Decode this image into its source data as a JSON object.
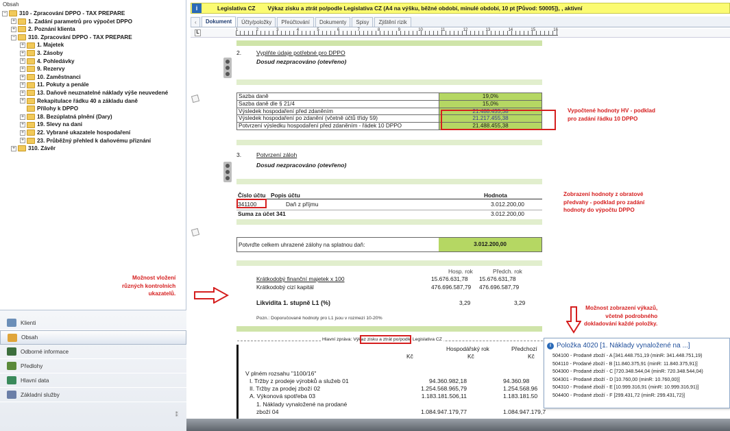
{
  "left_panel": {
    "title": "Obsah",
    "tree": [
      {
        "label": "310 - Zpracování DPPO - TAX PREPARE",
        "indent": 0,
        "exp": "−"
      },
      {
        "label": "1. Zadání parametrů pro výpočet DPPO",
        "indent": 1,
        "exp": "+"
      },
      {
        "label": "2. Poznání klienta",
        "indent": 1,
        "exp": "+"
      },
      {
        "label": "310. Zpracování DPPO - TAX PREPARE",
        "indent": 1,
        "exp": "−"
      },
      {
        "label": "1. Majetek",
        "indent": 2,
        "exp": "+"
      },
      {
        "label": "3. Zásoby",
        "indent": 2,
        "exp": "+"
      },
      {
        "label": "4. Pohledávky",
        "indent": 2,
        "exp": "+"
      },
      {
        "label": "9. Rezervy",
        "indent": 2,
        "exp": "+"
      },
      {
        "label": "10. Zaměstnanci",
        "indent": 2,
        "exp": "+"
      },
      {
        "label": "11. Pokuty a penále",
        "indent": 2,
        "exp": "+"
      },
      {
        "label": "13. Daňově neuznatelné náklady výše neuvedené",
        "indent": 2,
        "exp": "+"
      },
      {
        "label": "Rekapitulace řádku 40 a základu daně",
        "indent": 2,
        "exp": "+"
      },
      {
        "label": "Přílohy k DPPO",
        "indent": 2,
        "exp": ""
      },
      {
        "label": "18. Bezúplatná plnění (Dary)",
        "indent": 2,
        "exp": "+"
      },
      {
        "label": "19. Slevy na dani",
        "indent": 2,
        "exp": "+"
      },
      {
        "label": "22. Vybrané ukazatele hospodaření",
        "indent": 2,
        "exp": "+"
      },
      {
        "label": "23. Průběžný přehled k daňovému přiznání",
        "indent": 2,
        "exp": "+"
      },
      {
        "label": "310. Závěr",
        "indent": 1,
        "exp": "+"
      }
    ],
    "nav": [
      {
        "label": "Klienti",
        "icon": "clients-icon",
        "color": "#6c8fb8",
        "active": false
      },
      {
        "label": "Obsah",
        "icon": "content-icon",
        "color": "#e0a53a",
        "active": true
      },
      {
        "label": "Odborné informace",
        "icon": "library-icon",
        "color": "#3d6f3d",
        "active": false
      },
      {
        "label": "Předlohy",
        "icon": "templates-icon",
        "color": "#5b8a3a",
        "active": false
      },
      {
        "label": "Hlavní data",
        "icon": "main-data-icon",
        "color": "#3a8a5b",
        "active": false
      },
      {
        "label": "Základní služby",
        "icon": "services-icon",
        "color": "#6b7fa8",
        "active": false
      }
    ]
  },
  "topbar": {
    "section": "Legislativa CZ",
    "title": "Výkaz zisku a ztrát po/podle Legislativa CZ (A4 na výšku, běžné období, minulé období, 10 pt [Původ: 50005]), , aktivní"
  },
  "tabs": [
    "Dokument",
    "Účty/položky",
    "Přeúčtování",
    "Dokumenty",
    "Spisy",
    "Zjištění rizik"
  ],
  "ruler_marks": [
    "1",
    "2",
    "3",
    "4",
    "5",
    "6",
    "7",
    "8",
    "9",
    "10",
    "11",
    "12",
    "13",
    "14",
    "15",
    "16"
  ],
  "section2": {
    "num": "2.",
    "link": "Vyplňte údaje potřebné pro DPPO",
    "status": "Dosud nezpracováno (otevřeno)"
  },
  "tax_rows": [
    {
      "label": "Sazba daně",
      "value": "19,0%"
    },
    {
      "label": "Sazba daně dle § 21/4",
      "value": "15,0%"
    },
    {
      "label": "Výsledek hospodaření před zdaněním",
      "value": "21.488.455,38"
    },
    {
      "label": "Výsledek hospodaření po zdanění (včetně účtů třídy 59)",
      "value": "21.217.455,38"
    },
    {
      "label": "Potvrzení výsledku hospodaření před zdaněním - řádek 10 DPPO",
      "value": "21.488.455,38"
    }
  ],
  "section3": {
    "num": "3.",
    "link": "Potvrzení záloh",
    "status": "Dosud nezpracováno (otevřeno)"
  },
  "account": {
    "head_num": "Číslo účtu",
    "head_desc": "Popis účtu",
    "head_val": "Hodnota",
    "row_num": "341100",
    "row_desc": "Daň z příjmu",
    "row_val": "3.012.200,00",
    "sum_label": "Suma za účet 341",
    "sum_val": "3.012.200,00"
  },
  "confirm": {
    "label": "Potvrďte celkem uhrazené zálohy na splatnou daň:",
    "value": "3.012.200,00"
  },
  "liquidity": {
    "col1": "Hosp. rok",
    "col2": "Předch. rok",
    "rows": [
      {
        "label": "Krátkodobý finanční majetek x 100",
        "v1": "15.676.631,78",
        "v2": "15.676.631,78"
      },
      {
        "label": "Krátkodobý cizí kapitál",
        "v1": "476.696.587,79",
        "v2": "476.696.587,79"
      }
    ],
    "total_label": "Likvidita 1. stupně L1 (%)",
    "total_v1": "3,29",
    "total_v2": "3,29",
    "note": "Pozn.: Doporučované hodnoty pro L1 jsou v rozmezí 10-20%"
  },
  "report": {
    "header_pre": "Hlavní zpráva:",
    "header_box": "Výkaz zisku a ztrát",
    "header_post": "po/podle Legislativa CZ",
    "col_kc": "Kč",
    "col_year": "Hospodářský rok",
    "col_prev": "Předchozí",
    "rows": [
      {
        "label": "V plném rozsahu \"1100/16\"",
        "v1": "",
        "v2": ""
      },
      {
        "label": "I. Tržby z prodeje výrobků a služeb 01",
        "v1": "94.360.982,18",
        "v2": "94.360.98"
      },
      {
        "label": "II. Tržby za prodej zboží 02",
        "v1": "1.254.568.965,79",
        "v2": "1.254.568.96"
      },
      {
        "label": "A. Výkonová spotřeba 03",
        "v1": "1.183.181.506,11",
        "v2": "1.183.181.50"
      },
      {
        "label": "1. Náklady vynaložené na prodané",
        "v1": "",
        "v2": ""
      },
      {
        "label": "zboží 04",
        "v1": "1.084.947.179,77",
        "v2": "1.084.947.179,7"
      }
    ]
  },
  "annotations": {
    "hv": [
      "Vypočtené hodnoty HV - podklad",
      "pro zadání řádku 10 DPPO"
    ],
    "obrat": [
      "Zobrazení hodnoty z obratové",
      "předvahy - podklad pro zadání",
      "hodnoty do výpočtu DPPO"
    ],
    "kontrolni": [
      "Možnost vložení",
      "různých kontrolních",
      "ukazatelů."
    ],
    "vykaz": [
      "Možnost zobrazení výkazů,",
      "včetně podrobného",
      "dokladování každé položky."
    ]
  },
  "tooltip": {
    "title": "Položka 4020 [1. Náklady vynaložené na ...]",
    "lines": [
      "504100 - Prodané zboží - A [341.448.751,19 (minR: 341.448.751,19)",
      "504110 - Prodané zboží - B [11.840.375,91 (minR: 11.840.375,91)]",
      "504300 - Prodané zboží - C [720.348.544,04 (minR: 720.348.544,04)",
      "504301 - Prodané zboží - D [10.760,00 (minR: 10.760,00)]",
      "504310 - Prodané zboží - E [10.999.316,91 (minR: 10.999.316,91)]",
      "504400 - Prodané zboží - F [299.431,72 (minR: 299.431,72)]"
    ]
  },
  "colors": {
    "accent_green": "#b5d763",
    "topbar_yellow": "#fbfb72",
    "annotation_red": "#d51e1e",
    "link_blue": "#1d4d9a"
  }
}
